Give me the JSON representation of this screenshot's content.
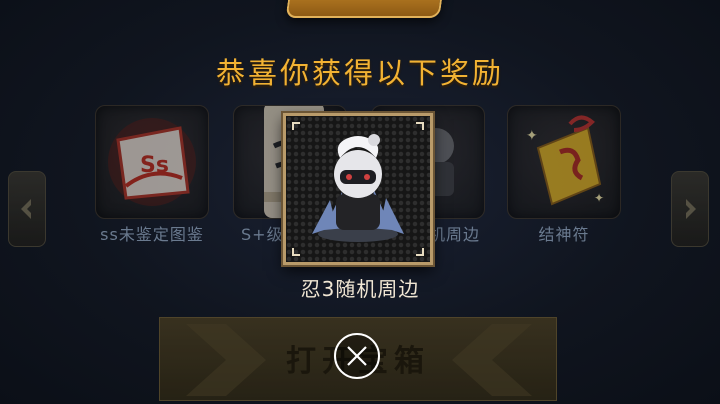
{
  "reward_title": "恭喜你获得以下奖励",
  "rewards": [
    {
      "label": "ss未鉴定图鉴",
      "icon": "ss-scroll-icon"
    },
    {
      "label": "S+级",
      "icon": "rolled-scroll-icon"
    },
    {
      "label": "机周边",
      "icon": "ninja-figure-icon"
    },
    {
      "label": "结神符",
      "icon": "talisman-icon"
    }
  ],
  "featured": {
    "label": "忍3随机周边",
    "icon": "ninja-chibi-figure-icon"
  },
  "open_button": {
    "label": "打开宝箱"
  },
  "colors": {
    "title": "#f2b233",
    "frame": "#b99b6a",
    "label_dim": "#6a7a8f"
  }
}
